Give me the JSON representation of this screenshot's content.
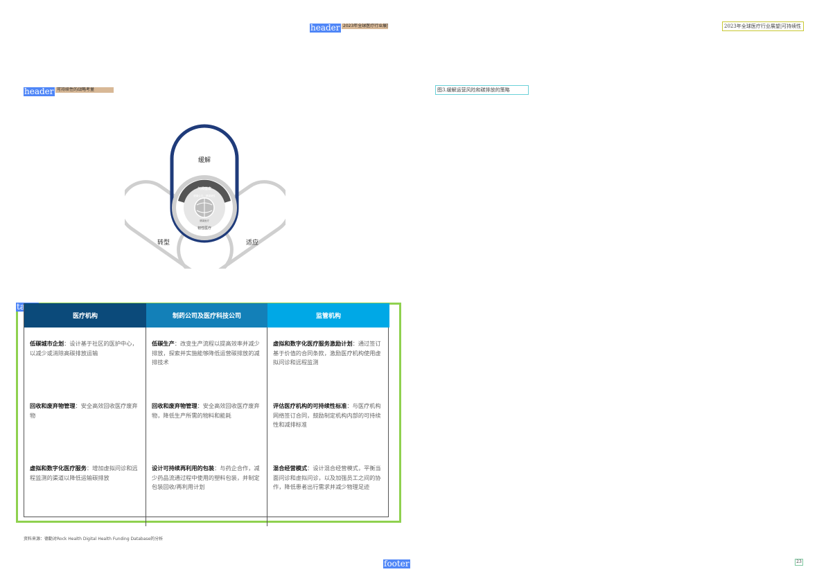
{
  "annotations": {
    "header_tag_1": "header",
    "header_tag_2": "header",
    "table_tag": "table",
    "footer_tag": "footer"
  },
  "header": {
    "strip_1_text": "2023年全球医疗行业展望",
    "strip_2_text": "可持续性的战略考量",
    "right_label": "2023年全球医疗行业展望|可持续性"
  },
  "figure": {
    "caption": "图3.缓解运营风险和碳排放的策略",
    "labels": {
      "top": "缓解",
      "left": "转型",
      "right": "适应",
      "ring_top": "气候健康",
      "ring_bottom": "韧性医疗",
      "center_upper": "健康公平、健康韧性",
      "center_lower": "健康医疗"
    }
  },
  "table": {
    "headers": [
      "医疗机构",
      "制药公司及医疗科技公司",
      "监管机构"
    ],
    "columns": [
      [
        {
          "bold": "低碳城市企划",
          "text": "：设计基于社区的医护中心，以减少或消除高碳排放运输"
        },
        {
          "bold": "回收和废弃物管理",
          "text": "：安全高效回收医疗废弃物"
        },
        {
          "bold": "虚拟和数字化医疗服务",
          "text": "：增加虚拟问诊和远程监测的渠道以降低运输碳排放"
        }
      ],
      [
        {
          "bold": "低碳生产",
          "text": "：改变生产流程以提高效率并减少排放，探索并实施能够降低运营碳排放的减排技术"
        },
        {
          "bold": "回收和废弃物管理",
          "text": "：安全高效回收医疗废弃物，降低生产所需的物料和能耗"
        },
        {
          "bold": "设计可持续再利用的包装",
          "text": "：与药企合作，减少药品流通过程中使用的塑料包装，并制定包装回收/再利用计划"
        }
      ],
      [
        {
          "bold": "虚拟和数字化医疗服务激励计划",
          "text": "：通过签订基于价值的合同条款，激励医疗机构使用虚拟问诊和远程监测"
        },
        {
          "bold": "评估医疗机构的可持续性标准",
          "text": "：与医疗机构网络签订合同，鼓励制定机构内部的可持续性和减排标准"
        },
        {
          "bold": "混合经营模式",
          "text": "：设计混合经营模式，平衡当面问诊和虚拟问诊，以及加强员工之间的协作，降低患者出行需求并减少物理足迹"
        }
      ]
    ]
  },
  "source_note": "资料来源：德勤对Rock Health Digital Health Funding Database的分析",
  "page_number": "23",
  "colors": {
    "header_col1": "#0b4a7a",
    "header_col2": "#1380b8",
    "header_col3": "#00a8e6",
    "loop_navy": "#1f3b7a",
    "loop_gray": "#cfcfcf",
    "table_frame": "#8fd14f",
    "annotation_tag": "#4f86f7"
  }
}
